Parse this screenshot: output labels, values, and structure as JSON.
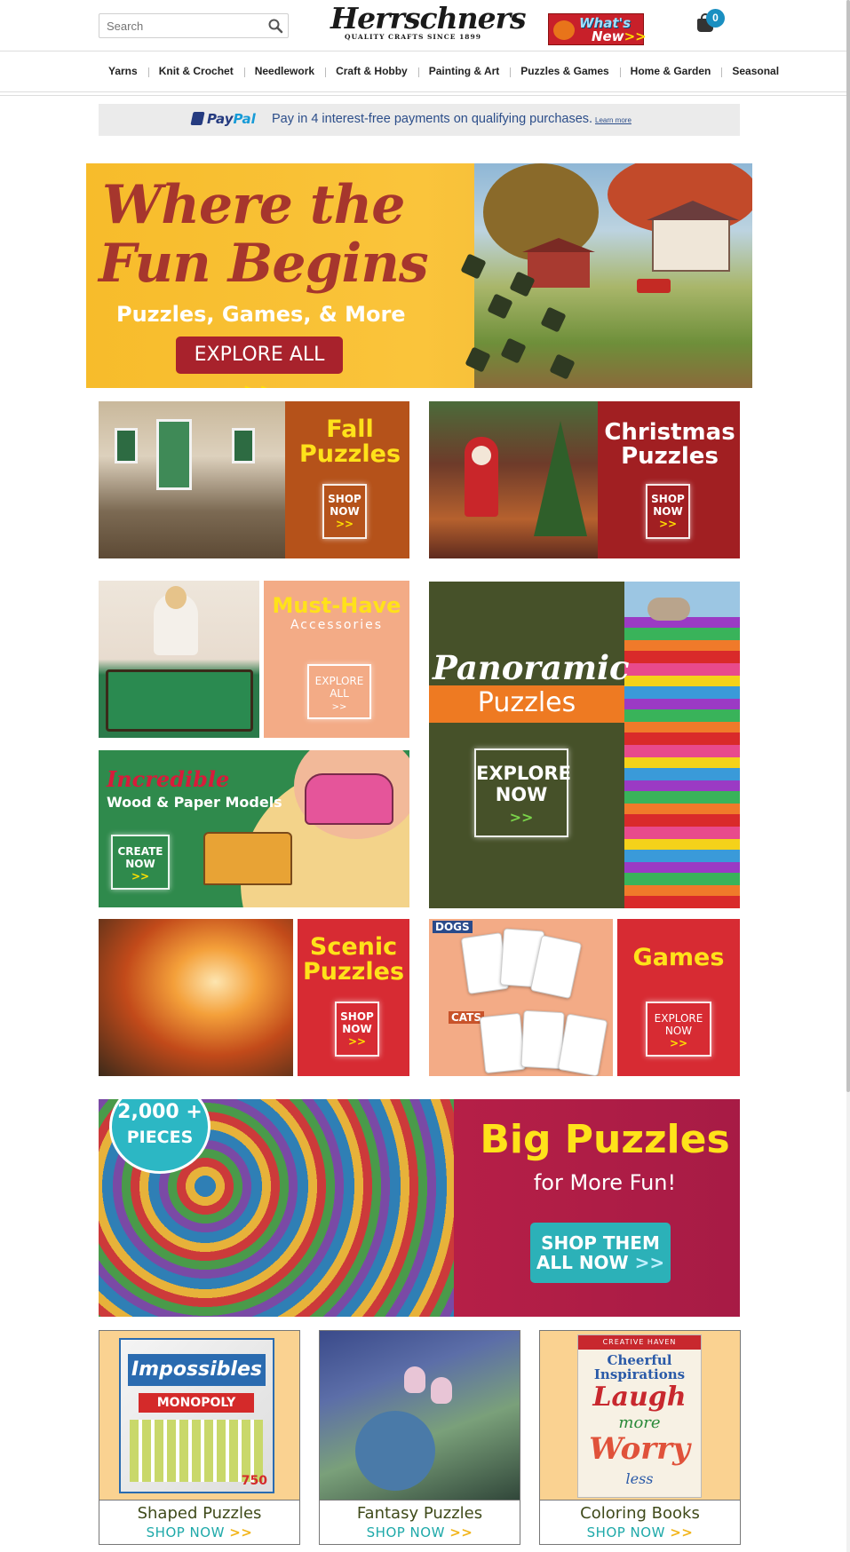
{
  "header": {
    "search_placeholder": "Search",
    "logo_brand": "Herrschners",
    "logo_tagline": "QUALITY CRAFTS SINCE 1899",
    "whats_new_line1": "What's",
    "whats_new_line2": "New",
    "whats_new_chev": ">>",
    "cart_count": "0"
  },
  "nav": {
    "items": [
      "Yarns",
      "Knit & Crochet",
      "Needlework",
      "Craft & Hobby",
      "Painting & Art",
      "Puzzles & Games",
      "Home & Garden",
      "Seasonal"
    ]
  },
  "paypal": {
    "logo_pay": "Pay",
    "logo_pal": "Pal",
    "text": "Pay in 4 interest-free payments on qualifying purchases.",
    "learn_more": "Learn more"
  },
  "hero": {
    "title_line1": "Where the",
    "title_line2": "Fun Begins",
    "subtitle": "Puzzles, Games, & More",
    "button": "EXPLORE ALL",
    "button_chev": ">>"
  },
  "tiles": {
    "fall": {
      "line1": "Fall",
      "line2": "Puzzles",
      "cta_line1": "SHOP",
      "cta_line2": "NOW",
      "chev": ">>"
    },
    "christmas": {
      "line1": "Christmas",
      "line2": "Puzzles",
      "cta_line1": "SHOP",
      "cta_line2": "NOW",
      "chev": ">>"
    },
    "accessories": {
      "line1": "Must-Have",
      "line2": "Accessories",
      "cta_line1": "EXPLORE",
      "cta_line2": "ALL",
      "chev": ">>"
    },
    "panoramic": {
      "line1": "Panoramic",
      "line2": "Puzzles",
      "cta_line1": "EXPLORE",
      "cta_line2": "NOW",
      "chev": ">>"
    },
    "wood": {
      "line1": "Incredible",
      "line2": "Wood & Paper Models",
      "cta_line1": "CREATE",
      "cta_line2": "NOW",
      "chev": ">>"
    },
    "scenic": {
      "line1": "Scenic",
      "line2": "Puzzles",
      "cta_line1": "SHOP",
      "cta_line2": "NOW",
      "chev": ">>"
    },
    "games": {
      "line1": "Games",
      "cta_line1": "EXPLORE",
      "cta_line2": "NOW",
      "chev": ">>",
      "card_label_dogs": "DOGS",
      "card_label_cats": "CATS"
    }
  },
  "big_puzzles": {
    "badge_line1": "2,000 +",
    "badge_line2": "PIECES",
    "title": "Big Puzzles",
    "subtitle": "for More Fun!",
    "btn_line1": "SHOP THEM",
    "btn_line2": "ALL NOW",
    "chev": ">>"
  },
  "cards": [
    {
      "name": "Shaped Puzzles",
      "shop": "SHOP NOW",
      "chev": ">>",
      "box_title": "Impossibles",
      "box_sub": "MONOPOLY",
      "box_num": "750"
    },
    {
      "name": "Fantasy Puzzles",
      "shop": "SHOP NOW",
      "chev": ">>"
    },
    {
      "name": "Coloring Books",
      "shop": "SHOP NOW",
      "chev": ">>",
      "book_series": "CREATIVE HAVEN",
      "book_title": "Cheerful Inspirations",
      "book_w1": "Laugh",
      "book_w2": "more",
      "book_w3": "Worry",
      "book_w4": "less"
    }
  ]
}
